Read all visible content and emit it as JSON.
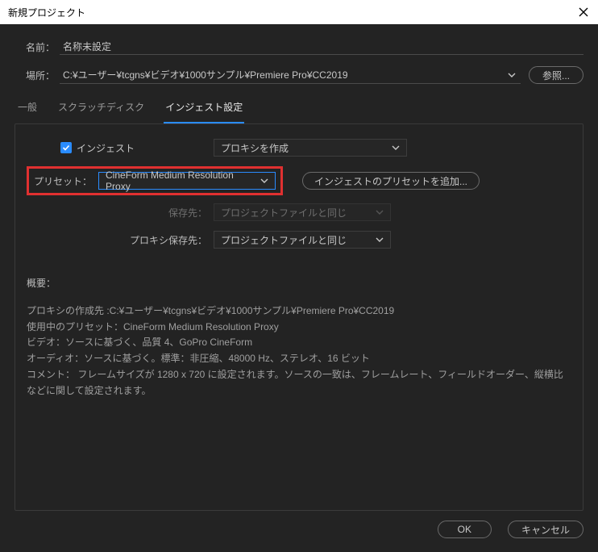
{
  "window": {
    "title": "新規プロジェクト"
  },
  "fields": {
    "name_label": "名前：",
    "name_value": "名称未設定",
    "location_label": "場所：",
    "location_value": "C:¥ユーザー¥tcgns¥ビデオ¥1000サンプル¥Premiere Pro¥CC2019",
    "browse_btn": "参照..."
  },
  "tabs": {
    "general": "一般",
    "scratch": "スクラッチディスク",
    "ingest": "インジェスト設定"
  },
  "ingest": {
    "checkbox_label": "インジェスト",
    "action_value": "プロキシを作成",
    "preset_label": "プリセット：",
    "preset_value": "CineForm Medium Resolution Proxy",
    "add_preset_btn": "インジェストのプリセットを追加...",
    "save_to_label": "保存先：",
    "save_to_value": "プロジェクトファイルと同じ",
    "proxy_save_to_label": "プロキシ保存先：",
    "proxy_save_to_value": "プロジェクトファイルと同じ"
  },
  "summary": {
    "heading": "概要：",
    "line1": "プロキシの作成先 :C:¥ユーザー¥tcgns¥ビデオ¥1000サンプル¥Premiere Pro¥CC2019",
    "line2": "使用中のプリセット：CineForm Medium Resolution Proxy",
    "line3": "ビデオ：ソースに基づく、品質 4、GoPro CineForm",
    "line4": "オーディオ：ソースに基づく。標準：非圧縮、48000 Hz、ステレオ、16 ビット",
    "line5": "コメント： フレームサイズが 1280 x 720 に設定されます。ソースの一致は、フレームレート、フィールドオーダー、縦横比などに関して設定されます。"
  },
  "footer": {
    "ok": "OK",
    "cancel": "キャンセル"
  }
}
